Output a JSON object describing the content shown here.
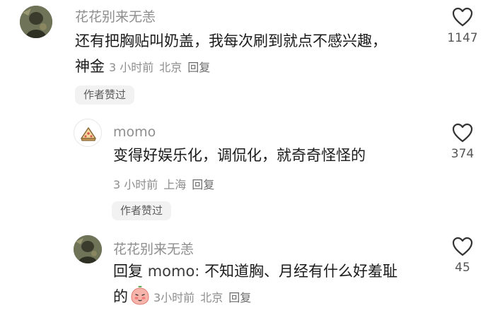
{
  "comments": [
    {
      "username": "花花别来无恙",
      "line1": "还有把胸贴叫奶盖，我每次刷到就点不感兴趣，",
      "line2": "神金",
      "time": "3 小时前",
      "location": "北京",
      "reply_label": "回复",
      "author_liked": "作者赞过",
      "like_count": "1147"
    },
    {
      "username": "momo",
      "line1": "变得好娱乐化，调侃化，就奇奇怪怪的",
      "time": "3 小时前",
      "location": "上海",
      "reply_label": "回复",
      "author_liked": "作者赞过",
      "like_count": "374"
    },
    {
      "username": "花花别来无恙",
      "reply_prefix": "回复",
      "reply_target": "momo:",
      "line1_rest": "不知道胸、月经有什么好羞耻",
      "line2": "的",
      "time": "3小时前",
      "location": "北京",
      "reply_label": "回复",
      "like_count": "45"
    }
  ]
}
